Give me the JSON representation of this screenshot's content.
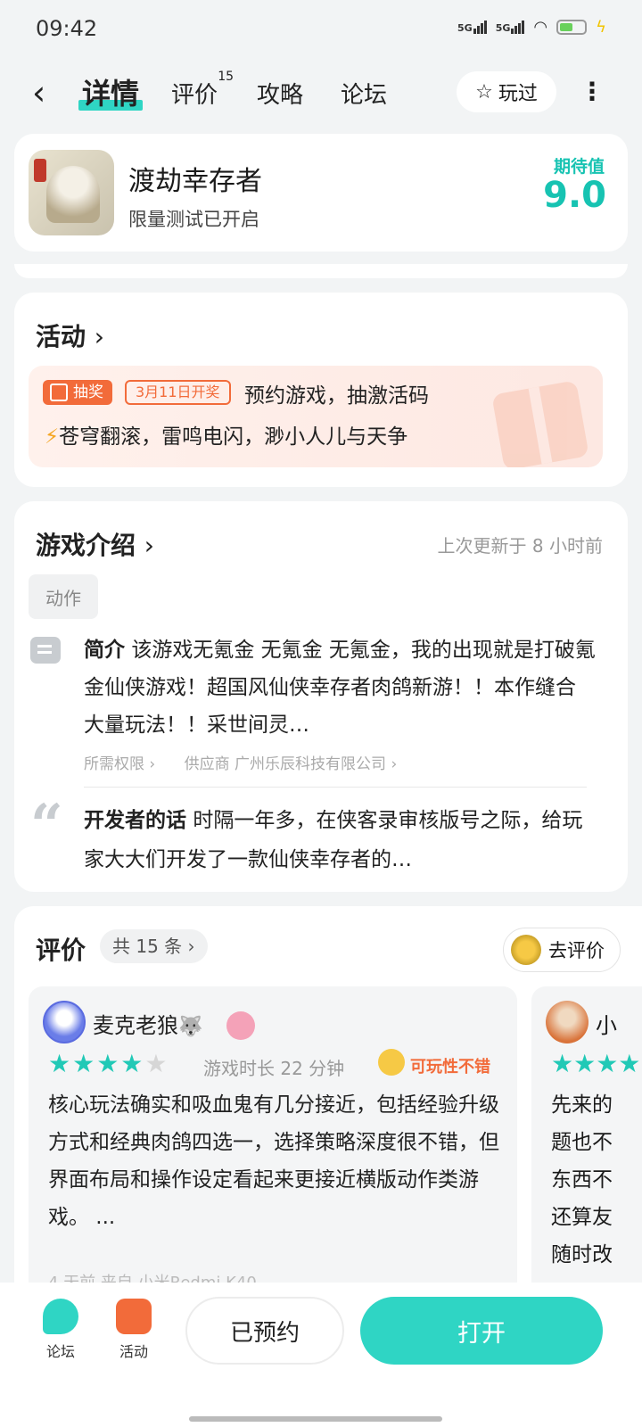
{
  "status": {
    "time": "09:42",
    "signal1": "5G",
    "signal2": "5G"
  },
  "nav": {
    "tabs": [
      {
        "label": "详情",
        "active": true
      },
      {
        "label": "评价",
        "count": "15"
      },
      {
        "label": "攻略"
      },
      {
        "label": "论坛"
      }
    ],
    "played_label": "玩过"
  },
  "game": {
    "title": "渡劫幸存者",
    "subtitle": "限量测试已开启",
    "expect_label": "期待值",
    "expect_value": "9.0"
  },
  "activity": {
    "title": "活动",
    "badge_draw": "抽奖",
    "badge_date": "3月11日开奖",
    "promo_title": "预约游戏，抽激活码",
    "promo_text": "苍穹翻滚，雷鸣电闪，渺小人儿与天争"
  },
  "intro": {
    "title": "游戏介绍",
    "updated": "上次更新于 8 小时前",
    "tag": "动作",
    "summary_label": "简介",
    "summary": "该游戏无氪金 无氪金 无氪金，我的出现就是打破氪金仙侠游戏！超国风仙侠幸存者肉鸽新游！！本作缝合大量玩法！！采世间灵…",
    "permissions": "所需权限",
    "supplier_label": "供应商",
    "supplier": "广州乐辰科技有限公司",
    "dev_label": "开发者的话",
    "dev_text": "时隔一年多，在侠客录审核版号之际，给玩家大大们开发了一款仙侠幸存者的…"
  },
  "reviews": {
    "title": "评价",
    "count": "共 15 条",
    "rate_label": "去评价",
    "items": [
      {
        "name": "麦克老狼",
        "emoji": "🐺",
        "rating": 4,
        "playtime": "游戏时长 22 分钟",
        "tag": "可玩性不错",
        "text": "核心玩法确实和吸血鬼有几分接近，包括经验升级方式和经典肉鸽四选一，选择策略深度很不错，但界面布局和操作设定看起来更接近横版动作类游戏。 ...",
        "footer": "4 天前  来自 小米Redmi K40"
      },
      {
        "name": "小",
        "rating": 5,
        "text": "先来的\n题也不\n东西不\n还算友\n随时改"
      }
    ]
  },
  "bottom": {
    "forum": "论坛",
    "activity": "活动",
    "reserved": "已预约",
    "open": "打开"
  }
}
